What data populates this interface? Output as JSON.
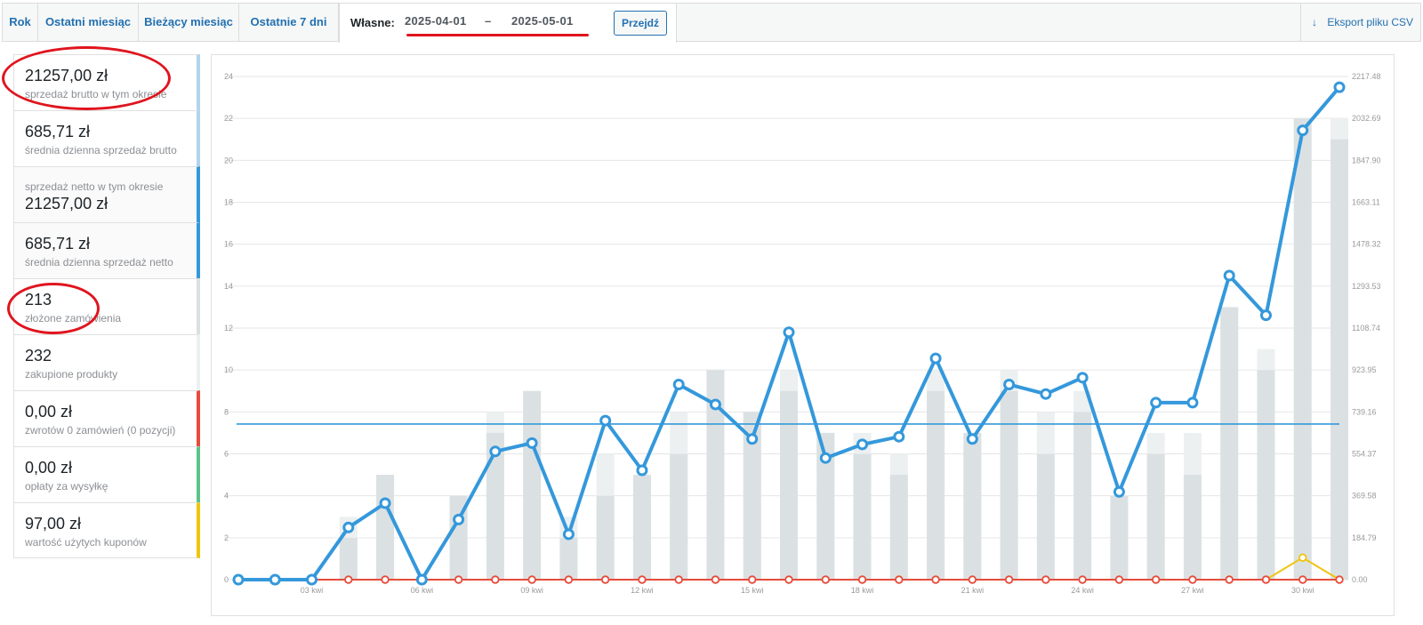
{
  "tabs": {
    "year": "Rok",
    "last_month": "Ostatni miesiąc",
    "current_month": "Bieżący miesiąc",
    "last_7_days": "Ostatnie 7 dni",
    "custom_label": "Własne:",
    "date_from": "2025-04-01",
    "date_separator": "–",
    "date_to": "2025-05-01",
    "go_button": "Przejdź",
    "export": "Eksport pliku CSV"
  },
  "legend": [
    {
      "amount": "21257,00 zł",
      "desc": "sprzedaż brutto w tym okresie",
      "color": "#b1d4ea"
    },
    {
      "amount": "685,71 zł",
      "desc": "średnia dzienna sprzedaż brutto",
      "color": "#b1d4ea"
    },
    {
      "amount": "21257,00 zł",
      "desc": "sprzedaż netto w tym okresie",
      "color": "#3498db"
    },
    {
      "amount": "685,71 zł",
      "desc": "średnia dzienna sprzedaż netto",
      "color": "#3498db"
    },
    {
      "amount": "213",
      "desc": "złożone zamówienia",
      "color": "#dbe1e3"
    },
    {
      "amount": "232",
      "desc": "zakupione produkty",
      "color": "#ecf0f1"
    },
    {
      "amount": "0,00 zł",
      "desc": "zwrotów 0 zamówień (0 pozycji)",
      "color": "#e74c3c"
    },
    {
      "amount": "0,00 zł",
      "desc": "opłaty za wysyłkę",
      "color": "#5cc488"
    },
    {
      "amount": "97,00 zł",
      "desc": "wartość użytych kuponów",
      "color": "#f1c40f"
    }
  ],
  "chart_data": {
    "type": "bar",
    "left_axis": {
      "ylim": [
        0,
        24
      ],
      "ticks": [
        "0",
        "2",
        "4",
        "6",
        "8",
        "10",
        "12",
        "14",
        "16",
        "18",
        "20",
        "22",
        "24"
      ]
    },
    "right_axis": {
      "ylim": [
        0,
        2217.48
      ],
      "ticks": [
        "0.00",
        "184.79",
        "369.58",
        "554.37",
        "739.16",
        "923.95",
        "1108.74",
        "1293.53",
        "1478.32",
        "1663.11",
        "1847.90",
        "2032.69",
        "2217.48"
      ]
    },
    "x_tick_labels": [
      {
        "index": 2,
        "label": "03 kwi"
      },
      {
        "index": 5,
        "label": "06 kwi"
      },
      {
        "index": 8,
        "label": "09 kwi"
      },
      {
        "index": 11,
        "label": "12 kwi"
      },
      {
        "index": 14,
        "label": "15 kwi"
      },
      {
        "index": 17,
        "label": "18 kwi"
      },
      {
        "index": 20,
        "label": "21 kwi"
      },
      {
        "index": 23,
        "label": "24 kwi"
      },
      {
        "index": 26,
        "label": "27 kwi"
      },
      {
        "index": 29,
        "label": "30 kwi"
      }
    ],
    "series": [
      {
        "name": "zakupione produkty",
        "color": "#ecf0f1",
        "axis": "left",
        "kind": "bar",
        "values": [
          0,
          0,
          0,
          3,
          5,
          0,
          4,
          8,
          9,
          3,
          6,
          5,
          8,
          10,
          8,
          10,
          7,
          7,
          6,
          10,
          7,
          10,
          8,
          9,
          4,
          7,
          7,
          13,
          11,
          22,
          22
        ]
      },
      {
        "name": "złożone zamówienia",
        "color": "#dbe1e3",
        "axis": "left",
        "kind": "bar",
        "values": [
          0,
          0,
          0,
          2,
          5,
          0,
          4,
          7,
          9,
          2,
          4,
          5,
          6,
          10,
          8,
          9,
          7,
          6,
          5,
          9,
          7,
          9,
          6,
          8,
          4,
          6,
          5,
          13,
          10,
          22,
          21
        ]
      },
      {
        "name": "sprzedaż netto w tym okresie",
        "color": "#3498db",
        "axis": "right",
        "kind": "line",
        "values": [
          0,
          0,
          0,
          230,
          337,
          0,
          265,
          565,
          602,
          200,
          701,
          482,
          860,
          772,
          620,
          1090,
          536,
          596,
          630,
          975,
          620,
          860,
          818,
          890,
          387,
          780,
          780,
          1340,
          1165,
          1980,
          2170
        ]
      },
      {
        "name": "średnia dzienna sprzedaż netto",
        "color": "#3498db",
        "axis": "right",
        "kind": "hline",
        "value": 685.71
      },
      {
        "name": "wartość użytych kuponów",
        "color": "#f1c40f",
        "axis": "right",
        "kind": "line",
        "values": [
          0,
          0,
          0,
          0,
          0,
          0,
          0,
          0,
          0,
          0,
          0,
          0,
          0,
          0,
          0,
          0,
          0,
          0,
          0,
          0,
          0,
          0,
          0,
          0,
          0,
          0,
          0,
          0,
          0,
          97,
          0
        ]
      },
      {
        "name": "zwrotów 0 zamówień (0 pozycji)",
        "color": "#e74c3c",
        "axis": "right",
        "kind": "line",
        "values": [
          0,
          0,
          0,
          0,
          0,
          0,
          0,
          0,
          0,
          0,
          0,
          0,
          0,
          0,
          0,
          0,
          0,
          0,
          0,
          0,
          0,
          0,
          0,
          0,
          0,
          0,
          0,
          0,
          0,
          0,
          0
        ]
      }
    ]
  }
}
